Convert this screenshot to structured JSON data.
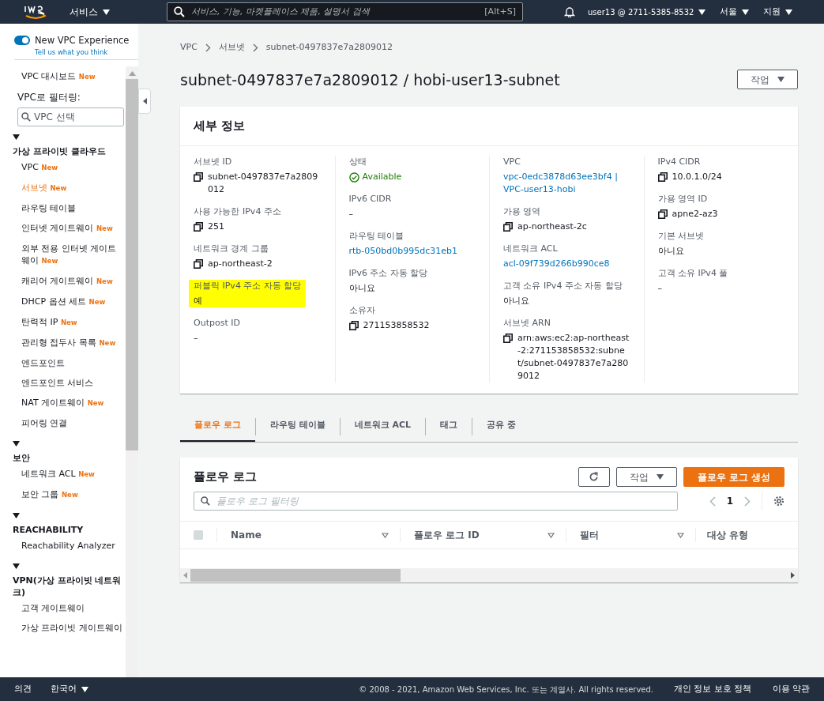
{
  "top_bar": {
    "services": "서비스",
    "search_placeholder": "서비스, 기능, 마켓플레이스 제품, 설명서 검색",
    "shortcut": "[Alt+S]",
    "account": "user13 @ 2711-5385-8532",
    "region": "서울",
    "support": "지원"
  },
  "sidebar": {
    "toggle": {
      "label": "New VPC Experience",
      "on": true,
      "sublabel": "Tell us what you think"
    },
    "entries": [
      {
        "kind": "item",
        "label": "VPC 대시보드",
        "badge": "New",
        "selected": false
      },
      {
        "kind": "filter_label",
        "label": "VPC로 필터링:"
      },
      {
        "kind": "search",
        "placeholder": "VPC 선택"
      },
      {
        "kind": "section",
        "title": "가상 프라이빗 클라우드",
        "expanded": true
      },
      {
        "kind": "item",
        "label": "VPC",
        "badge": "New",
        "selected": false
      },
      {
        "kind": "item",
        "label": "서브넷",
        "badge": "New",
        "selected": true
      },
      {
        "kind": "item",
        "label": "라우팅 테이블",
        "selected": false
      },
      {
        "kind": "item",
        "label": "인터넷 게이트웨이",
        "badge": "New",
        "selected": false
      },
      {
        "kind": "item",
        "label": "외부 전용 인터넷 게이트웨이",
        "badge": "New",
        "selected": false
      },
      {
        "kind": "item",
        "label": "캐리어 게이트웨이",
        "badge": "New",
        "selected": false
      },
      {
        "kind": "item",
        "label": "DHCP 옵션 세트",
        "badge": "New",
        "selected": false
      },
      {
        "kind": "item",
        "label": "탄력적 IP",
        "badge": "New",
        "selected": false
      },
      {
        "kind": "item",
        "label": "관리형 접두사 목록",
        "badge": "New",
        "selected": false
      },
      {
        "kind": "item",
        "label": "엔드포인트",
        "selected": false
      },
      {
        "kind": "item",
        "label": "엔드포인트 서비스",
        "selected": false
      },
      {
        "kind": "item",
        "label": "NAT 게이트웨이",
        "badge": "New",
        "selected": false
      },
      {
        "kind": "item",
        "label": "피어링 연결",
        "selected": false
      },
      {
        "kind": "section",
        "title": "보안",
        "expanded": true
      },
      {
        "kind": "item",
        "label": "네트워크 ACL",
        "badge": "New",
        "selected": false
      },
      {
        "kind": "item",
        "label": "보안 그룹",
        "badge": "New",
        "selected": false
      },
      {
        "kind": "section",
        "title": "REACHABILITY",
        "expanded": true
      },
      {
        "kind": "item",
        "label": "Reachability Analyzer",
        "selected": false
      },
      {
        "kind": "section",
        "title": "VPN(가상 프라이빗 네트워크)",
        "expanded": true
      },
      {
        "kind": "item",
        "label": "고객 게이트웨이",
        "selected": false
      },
      {
        "kind": "item",
        "label": "가상 프라이빗 게이트웨이",
        "selected": false
      }
    ]
  },
  "breadcrumb": [
    "VPC",
    "서브넷",
    "subnet-0497837e7a2809012"
  ],
  "page_title": "subnet-0497837e7a2809012 / hobi-user13-subnet",
  "actions_button": "작업",
  "details": {
    "title": "세부 정보",
    "columns": [
      [
        {
          "label": "서브넷 ID",
          "value": "subnet-0497837e7a2809012",
          "kind": "copy",
          "highlighted": false
        },
        {
          "label": "사용 가능한 IPv4 주소",
          "value": "251",
          "kind": "copy",
          "highlighted": false
        },
        {
          "label": "네트워크 경계 그룹",
          "value": "ap-northeast-2",
          "kind": "copy",
          "highlighted": false
        },
        {
          "label": "퍼블릭 IPv4 주소 자동 할당",
          "value": "예",
          "kind": "text",
          "highlighted": true
        },
        {
          "label": "Outpost ID",
          "value": "–",
          "kind": "text",
          "highlighted": false
        }
      ],
      [
        {
          "label": "상태",
          "value": "Available",
          "kind": "status",
          "highlighted": false
        },
        {
          "label": "IPv6 CIDR",
          "value": "–",
          "kind": "text",
          "highlighted": false
        },
        {
          "label": "라우팅 테이블",
          "value": "rtb-050bd0b995dc31eb1",
          "kind": "link",
          "highlighted": false
        },
        {
          "label": "IPv6 주소 자동 할당",
          "value": "아니요",
          "kind": "text",
          "highlighted": false
        },
        {
          "label": "소유자",
          "value": "271153858532",
          "kind": "copy",
          "highlighted": false
        }
      ],
      [
        {
          "label": "VPC",
          "value": "vpc-0edc3878d63ee3bf4 | VPC-user13-hobi",
          "kind": "link",
          "highlighted": false
        },
        {
          "label": "가용 영역",
          "value": "ap-northeast-2c",
          "kind": "copy",
          "highlighted": false
        },
        {
          "label": "네트워크 ACL",
          "value": "acl-09f739d266b990ce8",
          "kind": "link",
          "highlighted": false
        },
        {
          "label": "고객 소유 IPv4 주소 자동 할당",
          "value": "아니요",
          "kind": "text",
          "highlighted": false
        },
        {
          "label": "서브넷 ARN",
          "value": "arn:aws:ec2:ap-northeast-2:271153858532:subnet/subnet-0497837e7a2809012",
          "kind": "copy",
          "highlighted": false
        }
      ],
      [
        {
          "label": "IPv4 CIDR",
          "value": "10.0.1.0/24",
          "kind": "copy",
          "highlighted": false
        },
        {
          "label": "가용 영역 ID",
          "value": "apne2-az3",
          "kind": "copy",
          "highlighted": false
        },
        {
          "label": "기본 서브넷",
          "value": "아니요",
          "kind": "text",
          "highlighted": false
        },
        {
          "label": "고객 소유 IPv4 풀",
          "value": "–",
          "kind": "text",
          "highlighted": false
        }
      ]
    ]
  },
  "tabs": [
    {
      "label": "플로우 로그",
      "selected": true
    },
    {
      "label": "라우팅 테이블",
      "selected": false
    },
    {
      "label": "네트워크 ACL",
      "selected": false
    },
    {
      "label": "태그",
      "selected": false
    },
    {
      "label": "공유 중",
      "selected": false
    }
  ],
  "flow_logs": {
    "title": "플로우 로그",
    "actions_button": "작업",
    "create_button": "플로우 로그 생성",
    "filter_placeholder": "플로우 로그 필터링",
    "page": "1",
    "select_all_checked": false,
    "columns": [
      "Name",
      "플로우 로그 ID",
      "필터",
      "대상 유형"
    ]
  },
  "footer": {
    "feedback": "의견",
    "language": "한국어",
    "copyright": "© 2008 - 2021, Amazon Web Services, Inc. 또는 계열사. All rights reserved.",
    "links": [
      "개인 정보 보호 정책",
      "이용 약관"
    ]
  }
}
